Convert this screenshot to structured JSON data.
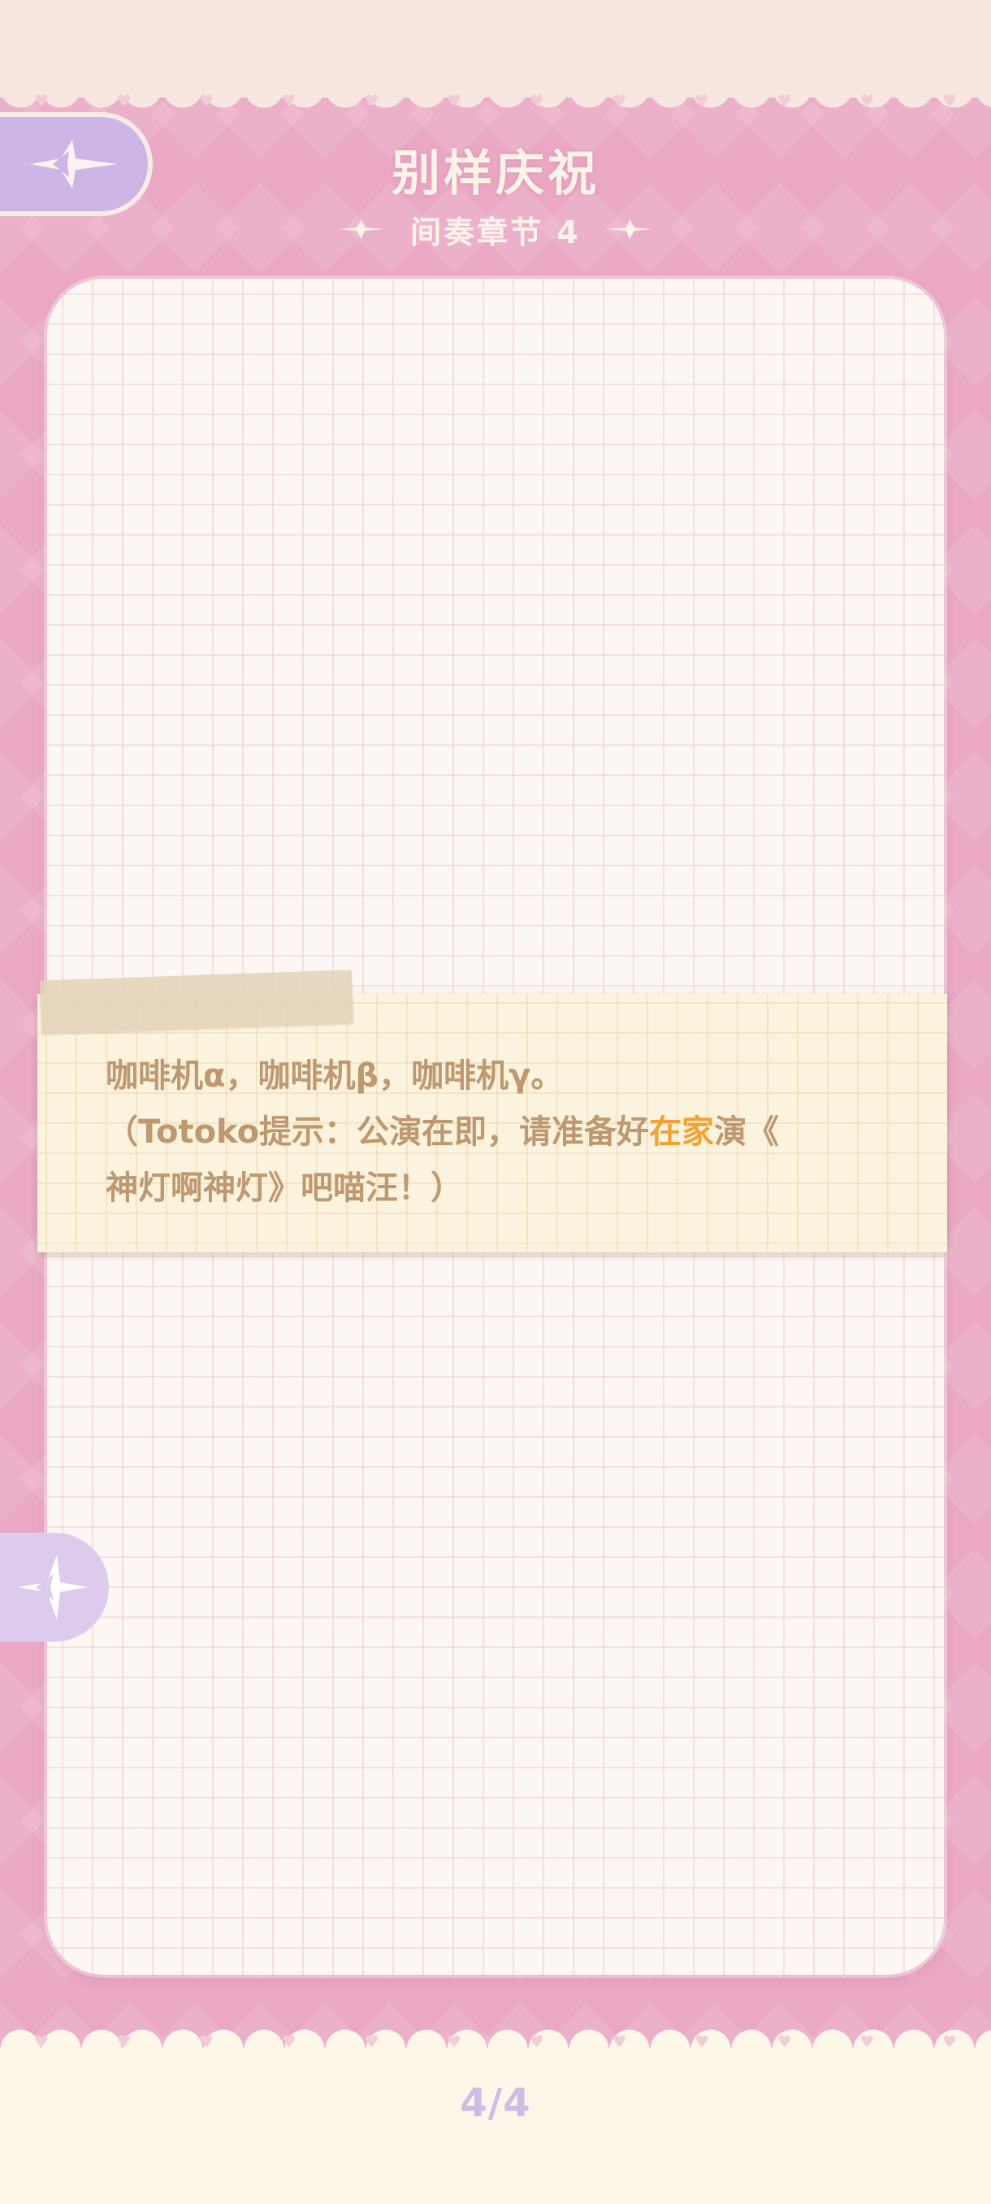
{
  "header": {
    "title": "别样庆祝",
    "subtitle": "间奏章节 4"
  },
  "note": {
    "line1": "咖啡机α，咖啡机β，咖啡机γ。",
    "line2_prefix": "（Totoko提示：公演在即，请准备好",
    "line2_highlight": "在家",
    "line2_suffix": "演《",
    "line3": "神灯啊神灯》吧喵汪！）"
  },
  "pager": {
    "label": "4/4"
  },
  "icons": {
    "back": "back-star-icon",
    "prev": "prev-arrow-star-icon",
    "sparkle": "sparkle-decoration-icon"
  },
  "colors": {
    "background_pink": "#eaa8c4",
    "paper": "#fcf7f2",
    "note_text": "#be9870",
    "highlight": "#f1a233",
    "button_lavender": "#cdb5e6",
    "title": "#fdf3e8"
  }
}
